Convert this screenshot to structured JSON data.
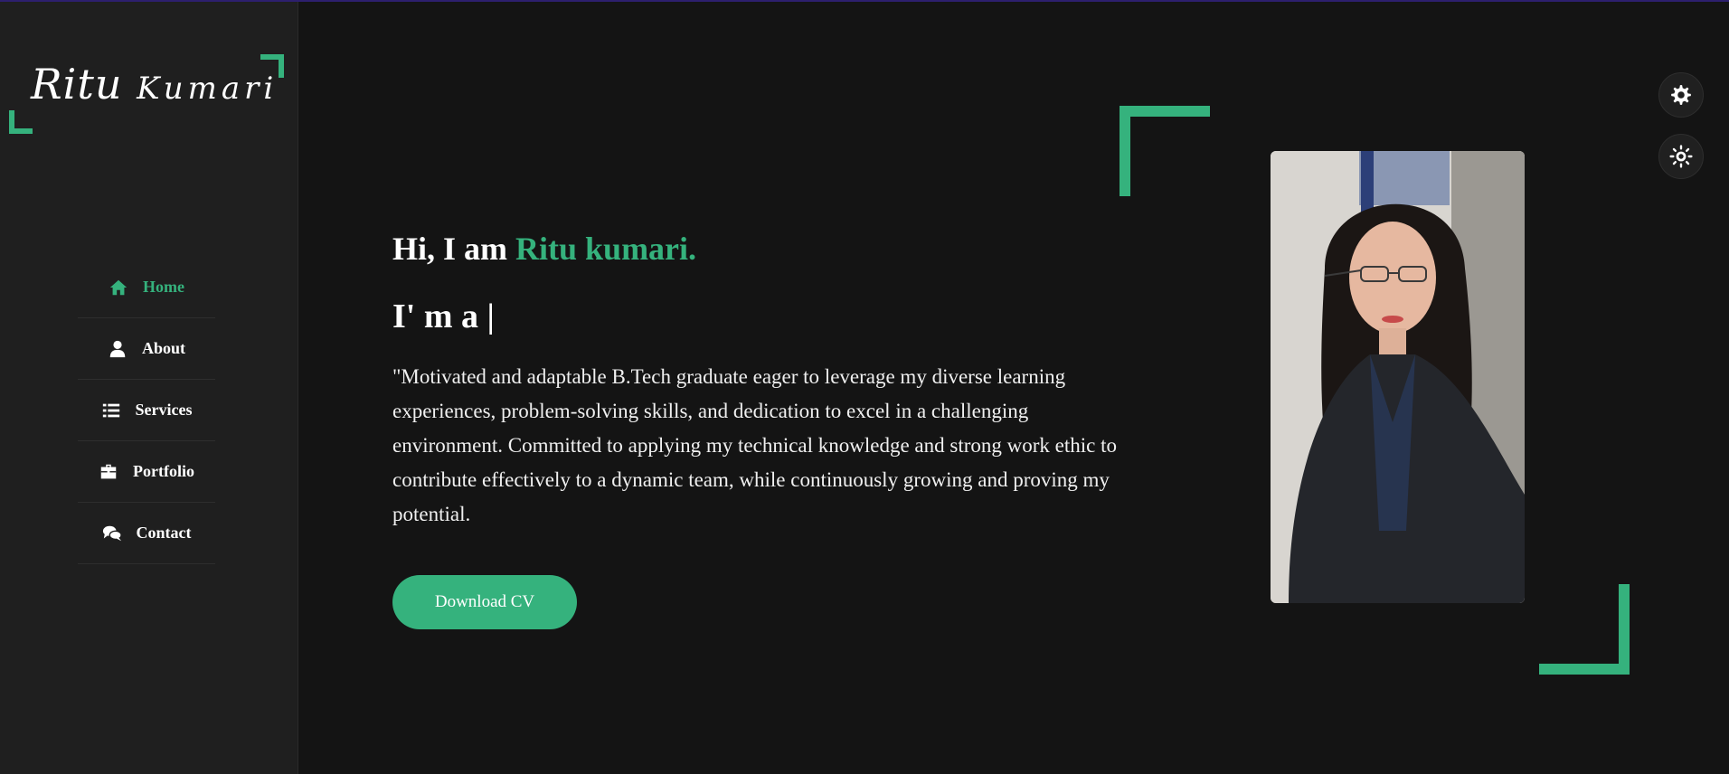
{
  "sidebar": {
    "logo": {
      "first": "Ritu",
      "last": "Kumari"
    },
    "nav": [
      {
        "label": "Home",
        "icon": "home-icon",
        "active": true
      },
      {
        "label": "About",
        "icon": "user-icon",
        "active": false
      },
      {
        "label": "Services",
        "icon": "list-icon",
        "active": false
      },
      {
        "label": "Portfolio",
        "icon": "briefcase-icon",
        "active": false
      },
      {
        "label": "Contact",
        "icon": "comments-icon",
        "active": false
      }
    ]
  },
  "hero": {
    "greeting_prefix": "Hi, I am ",
    "greeting_name": "Ritu kumari.",
    "typing_text": "I' m a |",
    "bio": "\"Motivated and adaptable B.Tech graduate eager to leverage my diverse learning experiences, problem-solving skills, and dedication to excel in a challenging environment. Committed to applying my technical knowledge and strong work ethic to contribute effectively to a dynamic team, while continuously growing and proving my potential.",
    "cv_button": "Download CV"
  },
  "controls": {
    "settings_icon": "gear-icon",
    "theme_icon": "sun-icon"
  },
  "colors": {
    "accent": "#35b27d",
    "background": "#141414",
    "sidebar": "#1f1f1f"
  }
}
